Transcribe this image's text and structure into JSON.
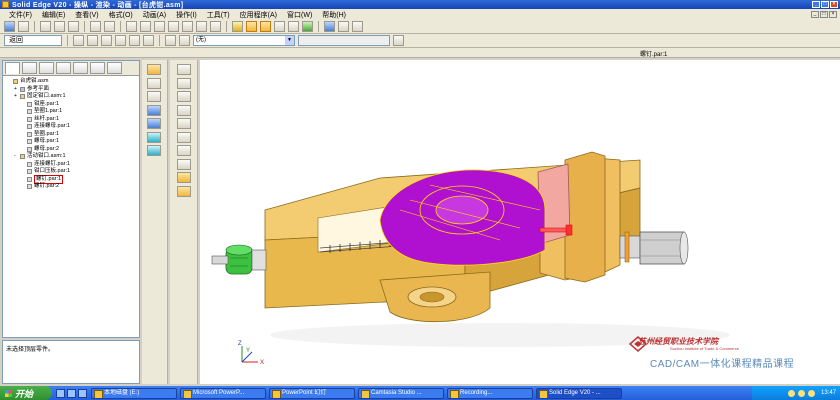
{
  "window": {
    "title": "Solid Edge V20 - 操纵 - 渲染 - 动画 - [台虎钳.asm]"
  },
  "menu": {
    "items": [
      "文件(F)",
      "编辑(E)",
      "查看(V)",
      "格式(O)",
      "动画(A)",
      "操作(I)",
      "工具(T)",
      "应用程序(A)",
      "窗口(W)",
      "帮助(H)"
    ]
  },
  "toolbar2": {
    "back_label": "返回",
    "select_value": "(无)"
  },
  "status": {
    "selected_part": "螺钉.par:1"
  },
  "pathfinder": {
    "tree": [
      {
        "label": "台虎钳.asm",
        "level": 0,
        "type": "asm",
        "expander": ""
      },
      {
        "label": "参考平面",
        "level": 1,
        "type": "plane",
        "expander": "+"
      },
      {
        "label": "固定钳口.asm:1",
        "level": 1,
        "type": "asm",
        "expander": "+"
      },
      {
        "label": "钳座.par:1",
        "level": 2,
        "type": "part",
        "expander": ""
      },
      {
        "label": "垫圈1.par:1",
        "level": 2,
        "type": "part",
        "expander": ""
      },
      {
        "label": "丝杆.par:1",
        "level": 2,
        "type": "part",
        "expander": ""
      },
      {
        "label": "连接螺母.par:1",
        "level": 2,
        "type": "part",
        "expander": ""
      },
      {
        "label": "垫圈.par:1",
        "level": 2,
        "type": "part",
        "expander": ""
      },
      {
        "label": "螺母.par:1",
        "level": 2,
        "type": "part",
        "expander": ""
      },
      {
        "label": "螺母.par:2",
        "level": 2,
        "type": "part",
        "expander": ""
      },
      {
        "label": "活动钳口.asm:1",
        "level": 1,
        "type": "asm",
        "expander": "-"
      },
      {
        "label": "连接螺钉.par:1",
        "level": 2,
        "type": "part",
        "expander": ""
      },
      {
        "label": "钳口压板.par:1",
        "level": 2,
        "type": "part",
        "expander": ""
      },
      {
        "label": "螺钉.par:1",
        "level": 2,
        "type": "part",
        "expander": "",
        "highlight": true
      },
      {
        "label": "螺钉.par:2",
        "level": 2,
        "type": "part",
        "expander": ""
      }
    ]
  },
  "prompt": {
    "text": "未选择顶层零件。"
  },
  "viewport": {
    "axis_x": "X",
    "axis_y": "Y",
    "axis_z": "Z",
    "school_name": "苏州经贸职业技术学院",
    "school_name_en": "Suzhou Institute of Trade & Commerce",
    "course_label": "CAD/CAM一体化课程精品课程"
  },
  "taskbar": {
    "start_label": "开始",
    "tasks": [
      "本地磁盘 (E:)",
      "Microsoft PowerP...",
      "PowerPoint 幻灯",
      "Camtasia Studio ...",
      "Recording...",
      "Solid Edge V20 - ..."
    ],
    "active_task_index": 5,
    "clock": "13:47"
  },
  "colors": {
    "part_body": "#f0c060",
    "part_edge": "#8a6a1c",
    "jaw_purple": "#b010d0",
    "jaw_pink": "#f2a8a0",
    "nut_green": "#3cc040",
    "titlebar": "#1f55c8"
  }
}
